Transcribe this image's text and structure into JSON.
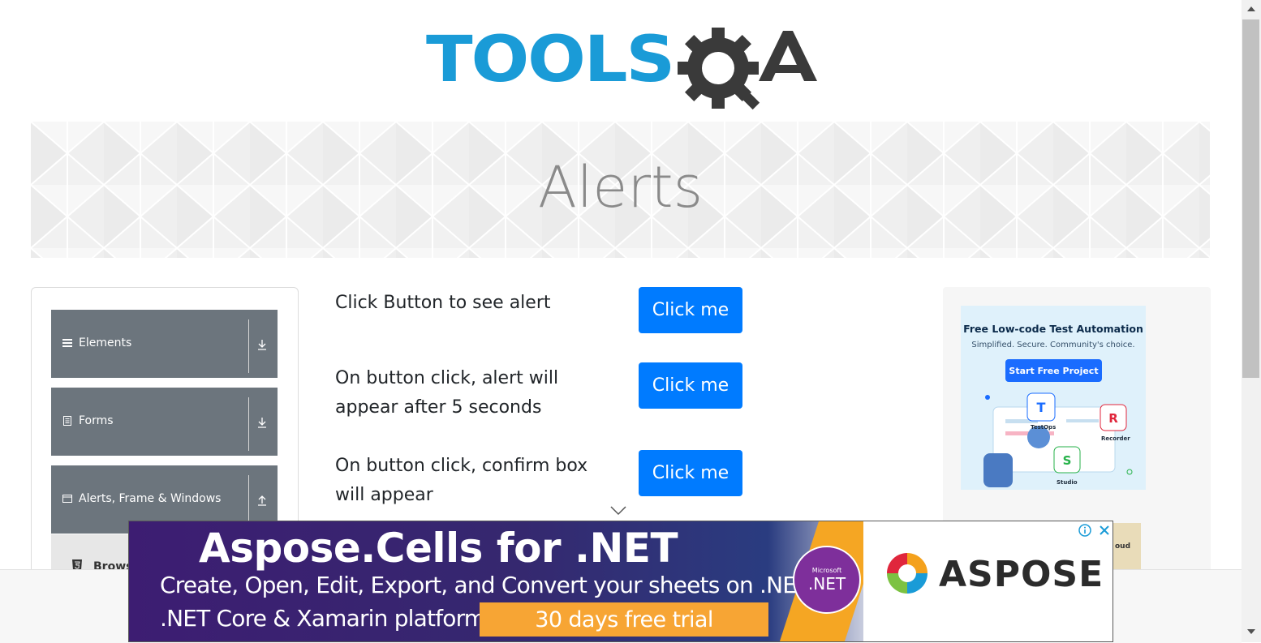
{
  "logo": {
    "text_part": "TOOLS",
    "qa_part": "QA"
  },
  "banner": {
    "title": "Alerts"
  },
  "sidebar": {
    "groups": [
      {
        "label": "Elements",
        "icon": "menu-icon",
        "arrow": "download-arrow-icon"
      },
      {
        "label": "Forms",
        "icon": "form-icon",
        "arrow": "download-arrow-icon"
      },
      {
        "label": "Alerts, Frame & Windows",
        "icon": "window-icon",
        "arrow": "upload-arrow-icon"
      }
    ],
    "sub_item": {
      "label": "Brows",
      "icon": "html5-icon"
    }
  },
  "main": {
    "rows": [
      {
        "text": "Click Button to see alert",
        "button": "Click me"
      },
      {
        "text": "On button click, alert will appear after 5 seconds",
        "button": "Click me"
      },
      {
        "text": "On button click, confirm box will appear",
        "button": "Click me"
      }
    ]
  },
  "right_ad": {
    "title": "Free Low-code Test Automation",
    "subtitle": "Simplified. Secure. Community's choice.",
    "cta": "Start Free Project",
    "labels": {
      "testops": "TestOps",
      "recorder": "Recorder",
      "studio": "Studio"
    },
    "clipped_text": "oud"
  },
  "bottom_ad": {
    "headline": "Aspose.Cells for .NET",
    "line2": "Create, Open, Edit, Export, and Convert your sheets on .NET,",
    "line3": ".NET Core & Xamarin platform.",
    "trial": "30 days free trial",
    "net_badge_top": "Microsoft",
    "net_badge": ".NET",
    "brand": "ASPOSE"
  },
  "colors": {
    "primary_button": "#007bff",
    "sidebar_group": "#6c757d",
    "logo_blue": "#1a9bd7",
    "logo_dark": "#3d3d3d"
  }
}
